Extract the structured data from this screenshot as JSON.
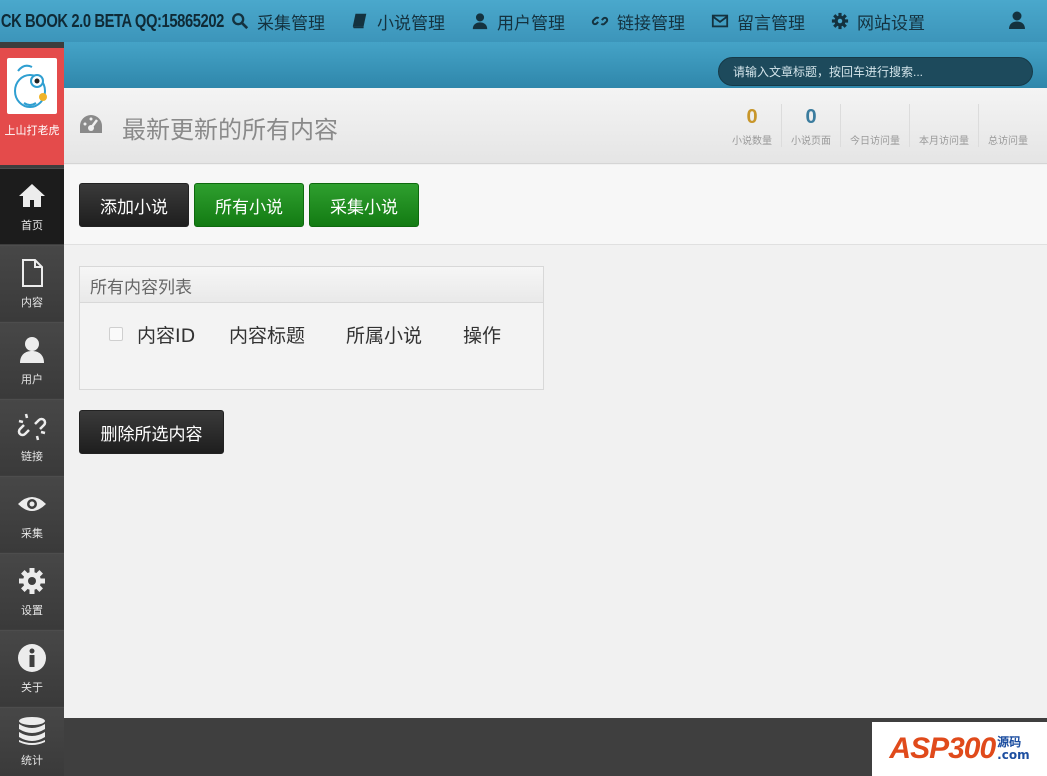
{
  "brand": "CK BOOK 2.0 BETA QQ:15865202",
  "nav": [
    {
      "label": "采集管理",
      "icon": "search-icon"
    },
    {
      "label": "小说管理",
      "icon": "book-icon"
    },
    {
      "label": "用户管理",
      "icon": "user-icon"
    },
    {
      "label": "链接管理",
      "icon": "link-icon"
    },
    {
      "label": "留言管理",
      "icon": "mail-icon"
    },
    {
      "label": "网站设置",
      "icon": "gear-icon"
    }
  ],
  "search": {
    "placeholder": "请输入文章标题，按回车进行搜索..."
  },
  "sidebar": {
    "user_name": "上山打老虎",
    "items": [
      {
        "label": "首页",
        "icon": "home-icon"
      },
      {
        "label": "内容",
        "icon": "file-icon"
      },
      {
        "label": "用户",
        "icon": "user-icon"
      },
      {
        "label": "链接",
        "icon": "unlink-icon"
      },
      {
        "label": "采集",
        "icon": "eye-icon"
      },
      {
        "label": "设置",
        "icon": "gear-icon"
      },
      {
        "label": "关于",
        "icon": "info-icon"
      },
      {
        "label": "统计",
        "icon": "database-icon"
      }
    ]
  },
  "header": {
    "title": "最新更新的所有内容",
    "stats": [
      {
        "value": "0",
        "label": "小说数量",
        "color": "#c8962a"
      },
      {
        "value": "0",
        "label": "小说页面",
        "color": "#3b7c9e"
      },
      {
        "value": "",
        "label": "今日访问量",
        "color": "#888888"
      },
      {
        "value": "",
        "label": "本月访问量",
        "color": "#888888"
      },
      {
        "value": "",
        "label": "总访问量",
        "color": "#888888"
      }
    ]
  },
  "buttons": {
    "add": "添加小说",
    "all": "所有小说",
    "collect": "采集小说",
    "delete": "删除所选内容"
  },
  "panel": {
    "title": "所有内容列表",
    "columns": [
      "内容ID",
      "内容标题",
      "所属小说",
      "操作"
    ]
  },
  "footer": {
    "logo_main": "ASP300",
    "logo_side_1": "源码",
    "logo_side_2": ".com"
  },
  "colors": {
    "topbar": "#4aa8cc",
    "sidebar": "#3d3d3d",
    "user_box": "#e44b4b",
    "green_button": "#1f8c1f"
  }
}
